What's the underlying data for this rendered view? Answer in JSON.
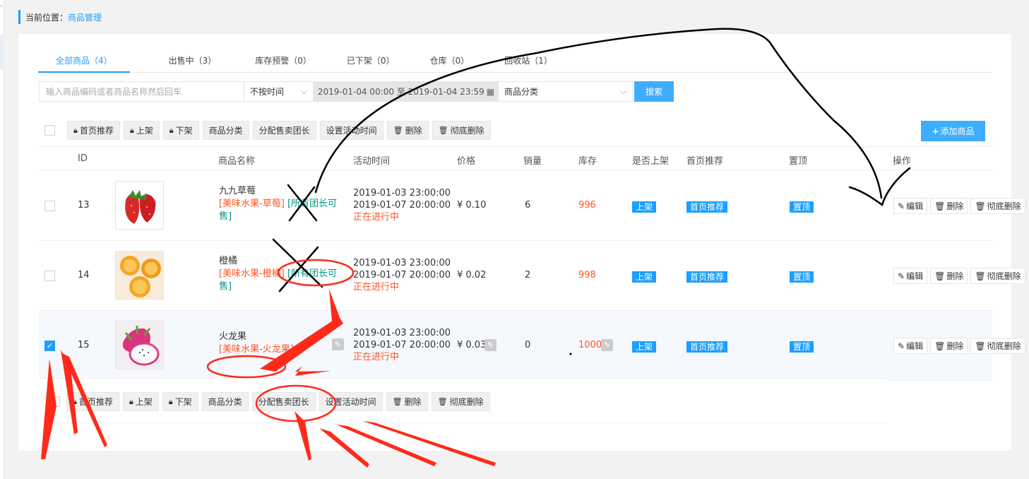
{
  "breadcrumb": {
    "prefix": "当前位置：",
    "current": "商品管理"
  },
  "tabs": [
    {
      "label": "全部商品（4）"
    },
    {
      "label": "出售中（3）"
    },
    {
      "label": "库存预警（0）"
    },
    {
      "label": "已下架（0）"
    },
    {
      "label": "仓库（0）"
    },
    {
      "label": "回收站（1）"
    }
  ],
  "filter": {
    "search_placeholder": "输入商品编码或者商品名称然后回车",
    "time_select": "不按时间",
    "date_range": "2019-01-04 00:00 至 2019-01-04 23:59",
    "category_select": "商品分类",
    "search_button": "搜索"
  },
  "toolbar": {
    "home_recommend": "首页推荐",
    "on_shelf": "上架",
    "off_shelf": "下架",
    "category": "商品分类",
    "assign_leader": "分配售卖团长",
    "set_time": "设置活动时间",
    "delete": "删除",
    "delete_forever": "彻底删除"
  },
  "add_button": "添加商品",
  "columns": {
    "id": "ID",
    "name": "商品名称",
    "time": "活动时间",
    "price": "价格",
    "sales": "销量",
    "stock": "库存",
    "on_shelf": "是否上架",
    "home": "首页推荐",
    "top": "置顶",
    "ops": "操作"
  },
  "rows": [
    {
      "id": "13",
      "name": "九九草莓",
      "category": "[美味水果-草莓]",
      "leader": "[所有团长可售]",
      "time_start": "2019-01-03 23:00:00",
      "time_end": "2019-01-07 20:00:00",
      "status": "正在进行中",
      "price": "¥ 0.10",
      "sales": "6",
      "stock": "996",
      "on_shelf": "上架",
      "home": "首页推荐",
      "top": "置顶",
      "edit": "编辑",
      "del": "删除",
      "del_forever": "彻底删除"
    },
    {
      "id": "14",
      "name": "橙橘",
      "category": "[美味水果-橙橘]",
      "leader": "[所有团长可售]",
      "time_start": "2019-01-03 23:00:00",
      "time_end": "2019-01-07 20:00:00",
      "status": "正在进行中",
      "price": "¥ 0.02",
      "sales": "2",
      "stock": "998",
      "on_shelf": "上架",
      "home": "首页推荐",
      "top": "置顶",
      "edit": "编辑",
      "del": "删除",
      "del_forever": "彻底删除"
    },
    {
      "id": "15",
      "name": "火龙果",
      "category": "[美味水果-火龙果]",
      "leader": "",
      "time_start": "2019-01-03 23:00:00",
      "time_end": "2019-01-07 20:00:00",
      "status": "正在进行中",
      "price": "¥ 0.03",
      "sales": "0",
      "stock": "1000",
      "on_shelf": "上架",
      "home": "首页推荐",
      "top": "置顶",
      "edit": "编辑",
      "del": "删除",
      "del_forever": "彻底删除"
    }
  ],
  "colors": {
    "primary": "#1e9fff",
    "danger": "#ff5722",
    "teal": "#009688",
    "annotation_red": "#ff2a1a",
    "annotation_black": "#000000"
  }
}
